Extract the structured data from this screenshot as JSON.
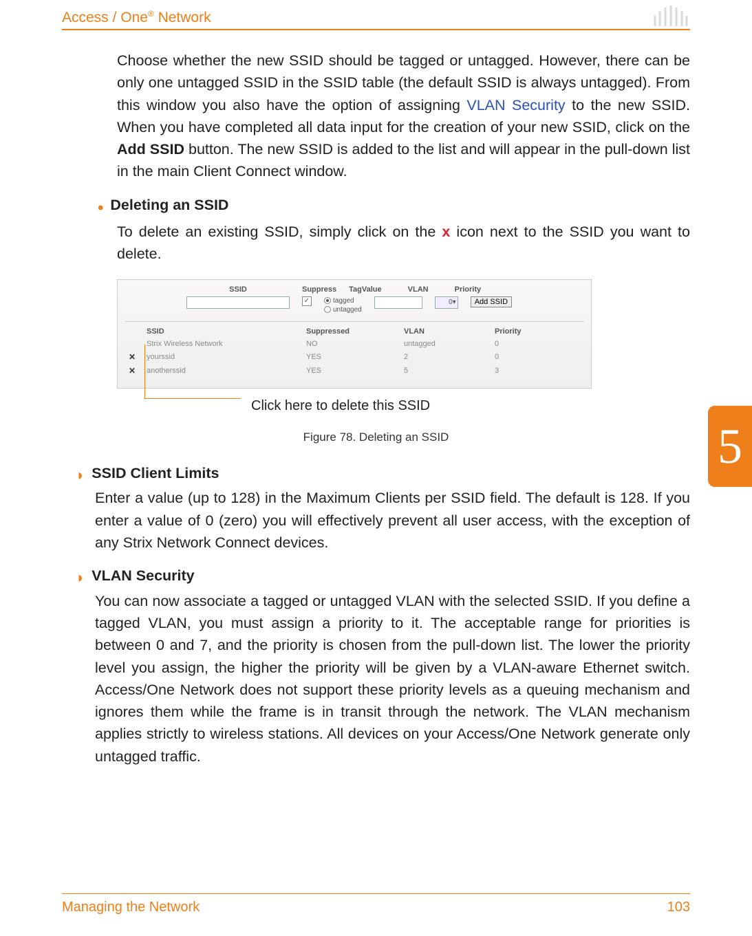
{
  "header": {
    "brand_prefix": "Access / One",
    "brand_reg": "®",
    "brand_suffix": " Network"
  },
  "chapter_number": "5",
  "para1_a": "Choose whether the new SSID should be tagged or untagged. However, there can be only one untagged SSID in the SSID table (the default SSID is always untagged). From this window you also have the option of assigning ",
  "para1_link": "VLAN Security",
  "para1_b": " to the new SSID. When you have completed all data input for the creation of your new SSID, click on the ",
  "para1_bold": "Add SSID",
  "para1_c": " button. The new SSID is added to the list and will appear in the pull-down list in the main Client Connect window.",
  "bullet1_title": "Deleting an SSID",
  "bullet1_body_a": "To delete an existing SSID, simply click on the ",
  "bullet1_body_x": "x",
  "bullet1_body_b": " icon next to the SSID you want to delete.",
  "figure": {
    "hdr_ssid": "SSID",
    "hdr_suppress": "Suppress",
    "hdr_tagvalue": "TagValue",
    "hdr_vlan": "VLAN",
    "hdr_priority": "Priority",
    "radio_tagged": "tagged",
    "radio_untagged": "untagged",
    "priority_val": "0",
    "add_btn": "Add SSID",
    "col_ssid": "SSID",
    "col_suppressed": "Suppressed",
    "col_vlan": "VLAN",
    "col_priority": "Priority",
    "rows": [
      {
        "x": "",
        "name": "Strix Wireless Network",
        "sup": "NO",
        "vlan": "untagged",
        "pri": "0"
      },
      {
        "x": "✕",
        "name": "yourssid",
        "sup": "YES",
        "vlan": "2",
        "pri": "0"
      },
      {
        "x": "✕",
        "name": "anotherssid",
        "sup": "YES",
        "vlan": "5",
        "pri": "3"
      }
    ]
  },
  "callout_text": "Click here to delete this SSID",
  "figure_caption": "Figure 78. Deleting an SSID",
  "sec2_title": "SSID Client Limits",
  "sec2_body": "Enter a value (up to 128) in the Maximum Clients per SSID field. The default is 128. If you enter a value of 0 (zero) you will effectively prevent all user access, with the exception of any Strix Network Connect devices.",
  "sec3_title": "VLAN Security",
  "sec3_body": "You can now associate a tagged or untagged VLAN with the selected SSID. If you define a tagged VLAN, you must assign a priority to it. The acceptable range for priorities is between 0 and 7, and the priority is chosen from the pull-down list. The lower the priority level you assign, the higher the priority will be given by a VLAN-aware Ethernet switch. Access/One Network does not support these priority levels as a queuing mechanism and ignores them while the frame is in transit through the network. The VLAN mechanism applies strictly to wireless stations. All devices on your Access/One Network generate only untagged traffic.",
  "footer": {
    "left": "Managing the Network",
    "right": "103"
  }
}
